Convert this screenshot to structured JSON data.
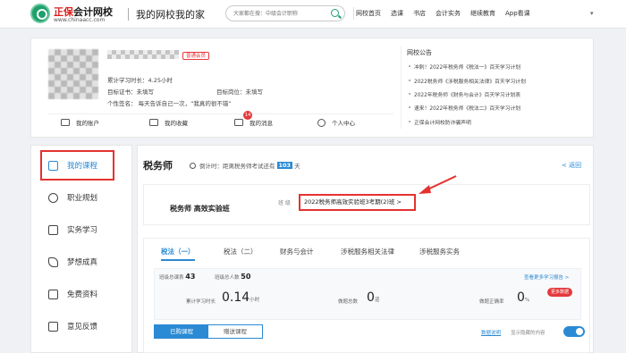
{
  "header": {
    "brand_name_red": "正保",
    "brand_name_rest": "会计网校",
    "brand_url": "www.chinaacc.com",
    "site_title": "我的网校我的家",
    "search_placeholder": "大家都在搜：中级会计职称",
    "nav": [
      "网校首页",
      "选课",
      "书店",
      "会计实务",
      "继续教育",
      "App看课"
    ]
  },
  "profile": {
    "badge": "普通会员",
    "study_time": "累计学习时长：4.25小时",
    "target_cert": "目标证书：未填写",
    "target_job": "目标岗位：未填写",
    "signature": "个性签名：  每天告诉自己一次，“我真的很不错”",
    "shortcuts": [
      "我的账户",
      "我的收藏",
      "我的消息",
      "个人中心"
    ],
    "message_count": "14"
  },
  "notices": {
    "title": "网校公告",
    "items": [
      "冲刺！2022年税务师《税法一》百天学习计划",
      "2022税务师《涉税服务相关法律》百天学习计划",
      "2022年税务师《财务与会计》百天学习计划表",
      "速来！2022年税务师《税法二》百天学习计划",
      "正保会计网校防诈骗声明"
    ]
  },
  "sidebar": {
    "items": [
      "我的课程",
      "职业规划",
      "实务学习",
      "梦想成真",
      "免费资料",
      "意见反馈"
    ]
  },
  "main": {
    "title": "税务师",
    "countdown_prefix": "倒计时：距离税务师考试还有",
    "countdown_days": "103",
    "countdown_suffix": "天",
    "back": "< 返回",
    "class_name": "税务师 高效实验班",
    "class_label": "班  级",
    "class_selected": "2022税务师高效实验班3考期(2)班 >",
    "tabs": [
      "税法（一）",
      "税法（二）",
      "财务与会计",
      "涉税服务相关法律",
      "涉税服务实务"
    ],
    "stats": {
      "lessons_total_label": "班级总课表",
      "lessons_total": "43",
      "students_label": "班级总人数",
      "students": "50",
      "study_time_label": "累计学习时长",
      "study_time_value": "0.14",
      "study_time_unit": "小时",
      "questions_label": "做题总数",
      "questions_value": "0",
      "questions_unit": "道",
      "accuracy_label": "做题正确率",
      "accuracy_value": "0",
      "accuracy_unit": "%",
      "more_link": "查看更多学习报告 >",
      "more_tag": "更多数据"
    },
    "course_tabs": [
      "已购课程",
      "赠送课程"
    ],
    "data_note": "数据说明",
    "hide_label": "显示隐藏的内容"
  }
}
